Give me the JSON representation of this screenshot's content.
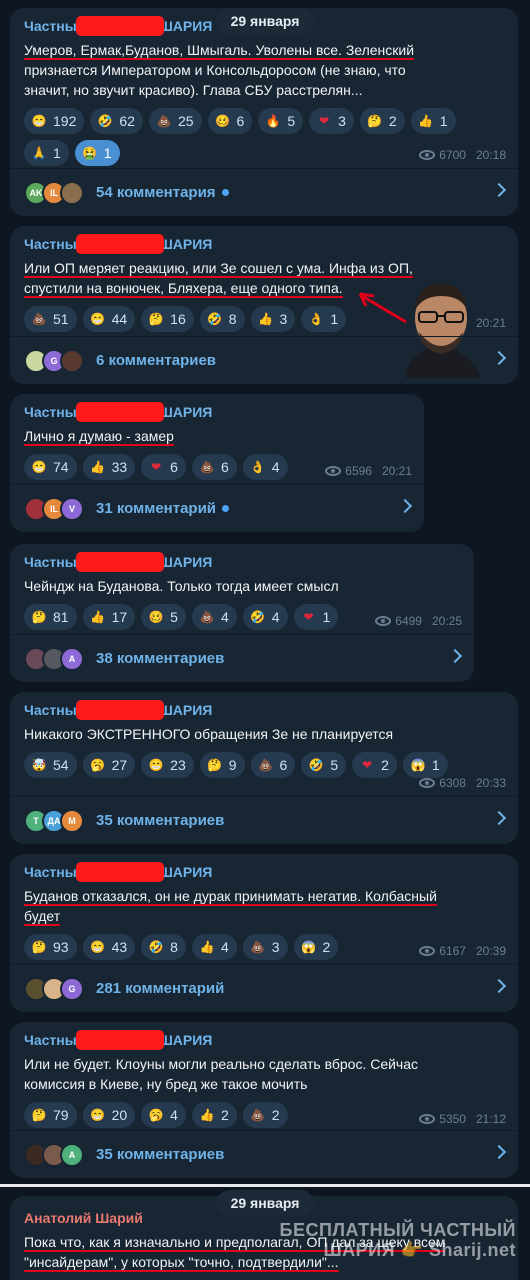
{
  "date_label": "29 января",
  "sender_prefix": "Частны",
  "sender_suffix": "ШАРИЯ",
  "messages": [
    {
      "lines": [
        "Умеров, Ермак,Буданов, Шмыгаль. Уволены все. Зеленский",
        "признается Императором и Консольдоросом (не знаю, что",
        "значит, но звучит красиво). Глава СБУ расстрелян..."
      ],
      "reactions": [
        {
          "icon": "grin-emoji",
          "glyph": "😁",
          "count": "192"
        },
        {
          "icon": "rofl-emoji",
          "glyph": "🤣",
          "count": "62"
        },
        {
          "icon": "poop-emoji",
          "glyph": "💩",
          "count": "25"
        },
        {
          "icon": "woozy-emoji",
          "glyph": "🥴",
          "count": "6"
        },
        {
          "icon": "fire-emoji",
          "glyph": "🔥",
          "count": "5"
        },
        {
          "icon": "heart-emoji",
          "glyph": "❤",
          "count": "3"
        },
        {
          "icon": "thinking-emoji",
          "glyph": "🤔",
          "count": "2"
        },
        {
          "icon": "thumbs-up-emoji",
          "glyph": "👍",
          "count": "1"
        },
        {
          "icon": "pray-emoji",
          "glyph": "🙏",
          "count": "1"
        },
        {
          "icon": "vomit-emoji",
          "glyph": "🤮",
          "count": "1"
        }
      ],
      "views": "6700",
      "time": "20:18",
      "avatars": [
        "AK",
        "IL",
        ""
      ],
      "comments": "54 комментария"
    },
    {
      "lines": [
        "Или ОП меряет реакцию, или Зе сошел с ума. Инфа из ОП,",
        "спустили на вонючек, Бляхера, еще одного типа."
      ],
      "reactions": [
        {
          "icon": "poop-emoji",
          "glyph": "💩",
          "count": "51"
        },
        {
          "icon": "grin-emoji",
          "glyph": "😁",
          "count": "44"
        },
        {
          "icon": "thinking-emoji",
          "glyph": "🤔",
          "count": "16"
        },
        {
          "icon": "rofl-emoji",
          "glyph": "🤣",
          "count": "8"
        },
        {
          "icon": "thumbs-up-emoji",
          "glyph": "👍",
          "count": "3"
        },
        {
          "icon": "ok-hand-emoji",
          "glyph": "👌",
          "count": "1"
        }
      ],
      "views": "",
      "time": "20:21",
      "avatars": [
        "",
        "G",
        ""
      ],
      "comments": "6 комментариев"
    },
    {
      "lines": [
        "Лично я думаю - замер"
      ],
      "reactions": [
        {
          "icon": "grin-emoji",
          "glyph": "😁",
          "count": "74"
        },
        {
          "icon": "thumbs-up-emoji",
          "glyph": "👍",
          "count": "33"
        },
        {
          "icon": "heart-emoji",
          "glyph": "❤",
          "count": "6"
        },
        {
          "icon": "poop-emoji",
          "glyph": "💩",
          "count": "6"
        },
        {
          "icon": "ok-hand-emoji",
          "glyph": "👌",
          "count": "4"
        }
      ],
      "views": "6596",
      "time": "20:21",
      "avatars": [
        "",
        "IL",
        "V"
      ],
      "comments": "31 комментарий"
    },
    {
      "lines": [
        "Чейндж на Буданова. Только тогда имеет смысл"
      ],
      "reactions": [
        {
          "icon": "thinking-emoji",
          "glyph": "🤔",
          "count": "81"
        },
        {
          "icon": "thumbs-up-emoji",
          "glyph": "👍",
          "count": "17"
        },
        {
          "icon": "woozy-emoji",
          "glyph": "🥴",
          "count": "5"
        },
        {
          "icon": "poop-emoji",
          "glyph": "💩",
          "count": "4"
        },
        {
          "icon": "rofl-emoji",
          "glyph": "🤣",
          "count": "4"
        },
        {
          "icon": "heart-emoji",
          "glyph": "❤",
          "count": "1"
        }
      ],
      "views": "6499",
      "time": "20:25",
      "avatars": [
        "",
        "",
        "A"
      ],
      "comments": "38 комментариев"
    },
    {
      "lines": [
        "Никакого ЭКСТРЕННОГО обращения Зе не планируется"
      ],
      "reactions": [
        {
          "icon": "exploding-head-emoji",
          "glyph": "🤯",
          "count": "54"
        },
        {
          "icon": "yawn-emoji",
          "glyph": "🥱",
          "count": "27"
        },
        {
          "icon": "grin-emoji",
          "glyph": "😁",
          "count": "23"
        },
        {
          "icon": "thinking-emoji",
          "glyph": "🤔",
          "count": "9"
        },
        {
          "icon": "poop-emoji",
          "glyph": "💩",
          "count": "6"
        },
        {
          "icon": "rofl-emoji",
          "glyph": "🤣",
          "count": "5"
        },
        {
          "icon": "heart-emoji",
          "glyph": "❤",
          "count": "2"
        },
        {
          "icon": "scream-emoji",
          "glyph": "😱",
          "count": "1"
        }
      ],
      "views": "6308",
      "time": "20:33",
      "avatars": [
        "T",
        "ДА",
        "M"
      ],
      "comments": "35 комментариев"
    },
    {
      "lines": [
        "Буданов отказался, он не дурак принимать негатив. Колбасный",
        "будет"
      ],
      "reactions": [
        {
          "icon": "thinking-emoji",
          "glyph": "🤔",
          "count": "93"
        },
        {
          "icon": "grin-emoji",
          "glyph": "😁",
          "count": "43"
        },
        {
          "icon": "rofl-emoji",
          "glyph": "🤣",
          "count": "8"
        },
        {
          "icon": "thumbs-up-emoji",
          "glyph": "👍",
          "count": "4"
        },
        {
          "icon": "poop-emoji",
          "glyph": "💩",
          "count": "3"
        },
        {
          "icon": "scream-emoji",
          "glyph": "😱",
          "count": "2"
        }
      ],
      "views": "6167",
      "time": "20:39",
      "avatars": [
        "",
        "",
        "G"
      ],
      "comments": "281 комментарий"
    },
    {
      "lines": [
        "Или не будет. Клоуны могли реально сделать вброс. Сейчас",
        "комиссия в Киеве, ну бред же такое мочить"
      ],
      "reactions": [
        {
          "icon": "thinking-emoji",
          "glyph": "🤔",
          "count": "79"
        },
        {
          "icon": "grin-emoji",
          "glyph": "😁",
          "count": "20"
        },
        {
          "icon": "yawn-emoji",
          "glyph": "🥱",
          "count": "4"
        },
        {
          "icon": "thumbs-up-emoji",
          "glyph": "👍",
          "count": "2"
        },
        {
          "icon": "poop-emoji",
          "glyph": "💩",
          "count": "2"
        }
      ],
      "views": "5350",
      "time": "21:12",
      "avatars": [
        "",
        "",
        "A"
      ],
      "comments": "35 комментариев"
    }
  ],
  "last": {
    "sender": "Анатолий Шарий",
    "lines": [
      "Пока что, как я изначально и предполагал, ОП дал за щеку всем",
      "\"инсайдерам\", у которых \"точно, подтвердили\"..."
    ]
  },
  "watermark": [
    "БЕСПЛАТНЫЙ ЧАСТНЫЙ",
    "ШАРИЯ 👉 Sharij.net"
  ]
}
